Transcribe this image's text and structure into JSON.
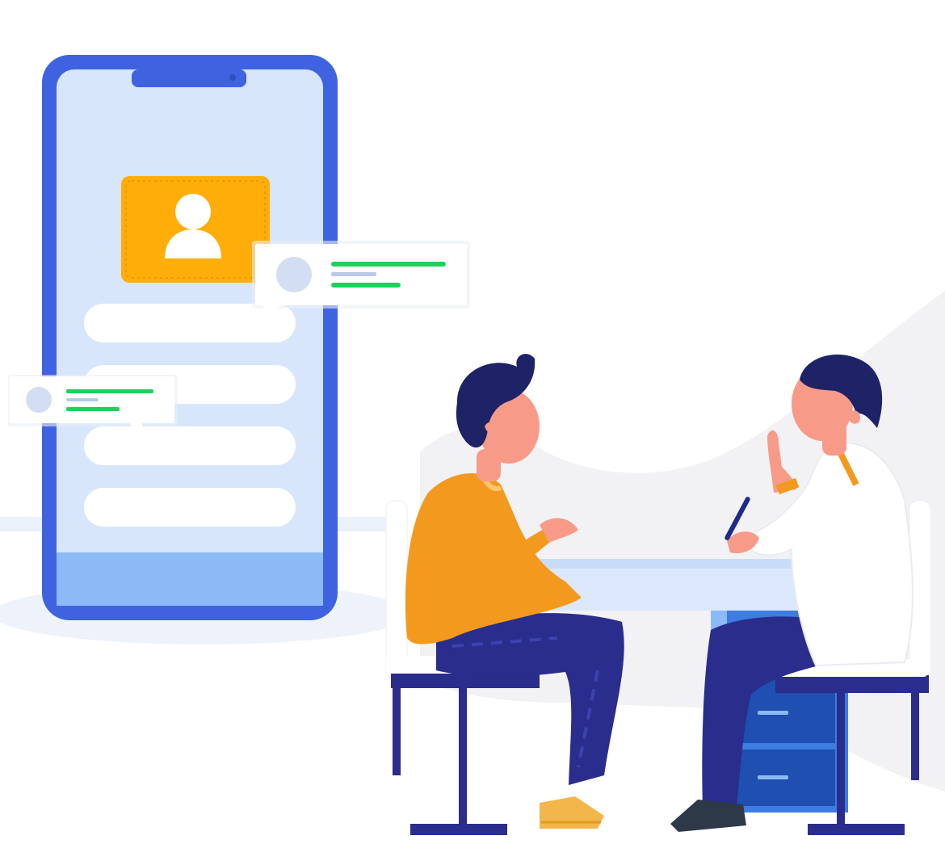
{
  "illustration": {
    "subject": "",
    "colors": {
      "background": "#ffffff",
      "backdrop_blob": "#f2f2f4",
      "floor_band": "#eaf1fb",
      "phone_frame": "#3f63e0",
      "phone_screen": "#d7e6fb",
      "phone_bottom_bar": "#8cbaf6",
      "profile_card": "#ffad08",
      "chat_bubble": "#ffffff",
      "chat_avatar": "#d3def3",
      "chat_line_green": "#1fd15a",
      "chat_line_grey": "#bac9e4",
      "patient_shirt": "#f39a1e",
      "trousers": "#2a2d8c",
      "hair": "#1e2266",
      "skin": "#f89a88",
      "doctor_coat": "#ffffff",
      "desk_top": "#dbe8fb",
      "drawer_unit": "#1f4fb0",
      "chair_frame": "#2a2d8c",
      "shoes": "#f2b64a"
    },
    "icons": [
      "user-avatar-icon",
      "chat-bubble-icon"
    ]
  }
}
